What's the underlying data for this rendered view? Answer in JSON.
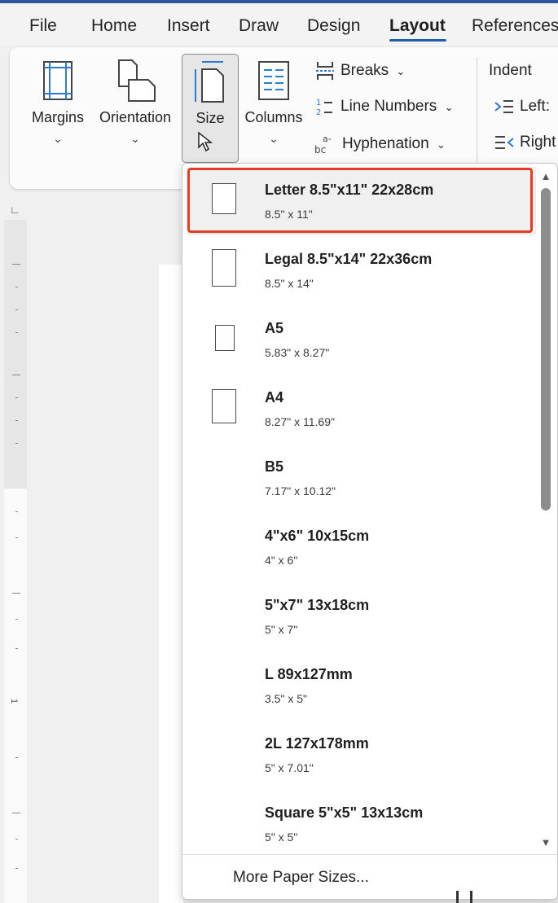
{
  "tabs": [
    {
      "label": "File"
    },
    {
      "label": "Home"
    },
    {
      "label": "Insert"
    },
    {
      "label": "Draw"
    },
    {
      "label": "Design"
    },
    {
      "label": "Layout"
    },
    {
      "label": "References"
    }
  ],
  "active_tab": "Layout",
  "ribbon": {
    "margins_label": "Margins",
    "orientation_label": "Orientation",
    "size_label": "Size",
    "columns_label": "Columns",
    "breaks_label": "Breaks",
    "line_numbers_label": "Line Numbers",
    "hyphenation_label": "Hyphenation",
    "indent_label": "Indent",
    "indent_left_label": "Left:",
    "indent_right_label": "Right"
  },
  "size_menu": {
    "items": [
      {
        "name": "Letter 8.5\"x11\" 22x28cm",
        "dims": "8.5\" x 11\"",
        "icon": "portrait-page-icon"
      },
      {
        "name": "Legal 8.5\"x14\" 22x36cm",
        "dims": "8.5\" x 14\"",
        "icon": "tall-page-icon"
      },
      {
        "name": "A5",
        "dims": "5.83\" x 8.27\"",
        "icon": "small-page-icon"
      },
      {
        "name": "A4",
        "dims": "8.27\" x 11.69\"",
        "icon": "portrait-page-icon"
      },
      {
        "name": "B5",
        "dims": "7.17\" x 10.12\""
      },
      {
        "name": "4\"x6\" 10x15cm",
        "dims": "4\" x 6\""
      },
      {
        "name": "5\"x7\" 13x18cm",
        "dims": "5\" x 7\""
      },
      {
        "name": "L 89x127mm",
        "dims": "3.5\" x 5\""
      },
      {
        "name": "2L 127x178mm",
        "dims": "5\" x 7.01\""
      },
      {
        "name": "Square 5\"x5\" 13x13cm",
        "dims": "5\" x 5\""
      }
    ],
    "selected": "Letter 8.5\"x11\" 22x28cm",
    "more_label": "More Paper Sizes...",
    "highlight_color": "#e53c24"
  },
  "ruler": {
    "marker": "1"
  }
}
